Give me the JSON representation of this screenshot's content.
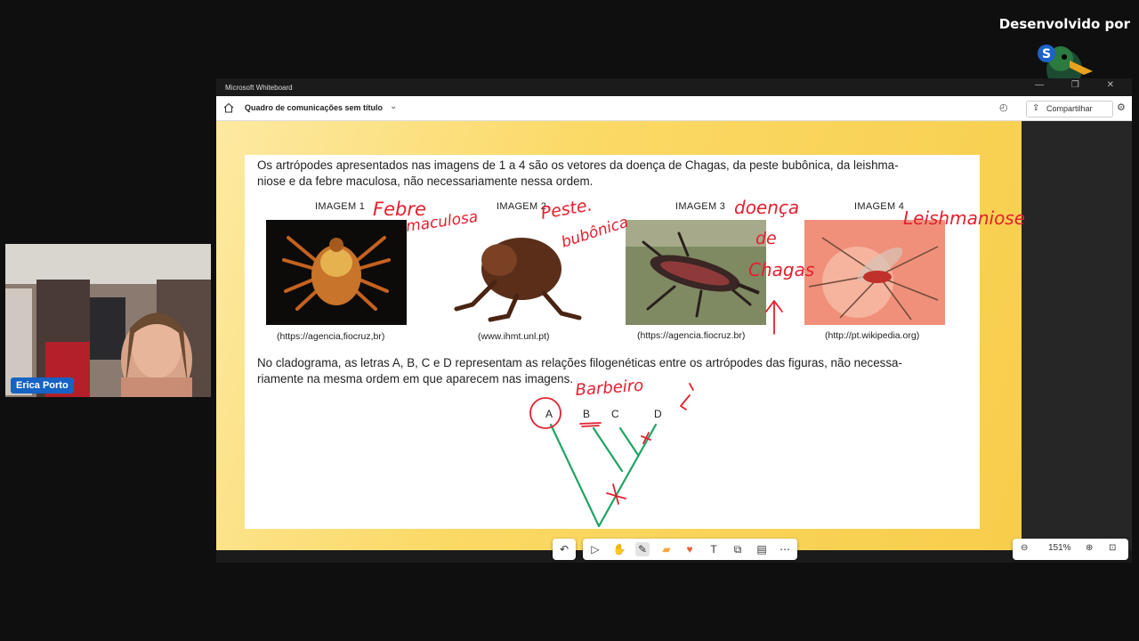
{
  "stream": {
    "brand_text": "Desenvolvido por",
    "presenter_name": "Erica Porto"
  },
  "window": {
    "app_title": "Microsoft Whiteboard",
    "board_title": "Quadro de comunicações sem título",
    "share_label": "Compartilhar"
  },
  "slide": {
    "intro_text": [
      "Os artrópodes apresentados nas imagens de 1 a 4 são os vetores da doença de Chagas, da peste bubônica, da leishma-",
      "niose e da febre maculosa, não necessariamente nessa ordem."
    ],
    "images": [
      {
        "label": "IMAGEM 1",
        "source": "(https://agencia,fiocruz,br)",
        "handwritten": [
          "Febre",
          "maculosa"
        ]
      },
      {
        "label": "IMAGEM 2",
        "source": "(www.ihmt.unl.pt)",
        "handwritten": [
          "Peste.",
          "bubônica"
        ]
      },
      {
        "label": "IMAGEM 3",
        "source": "(https://agencia.fiocruz.br)",
        "handwritten": [
          "doença",
          "de",
          "Chagas"
        ]
      },
      {
        "label": "IMAGEM 4",
        "source": "(http://pt.wikipedia.org)",
        "handwritten": [
          "Leishmaniose"
        ]
      }
    ],
    "clado_text": [
      "No cladograma, as letras A, B, C e D representam as relações filogenéticas entre os artrópodes das figuras, não necessa-",
      "riamente na mesma ordem em que aparecem nas imagens."
    ],
    "clado_letters": [
      "A",
      "B",
      "C",
      "D"
    ],
    "clado_annotation": "Barbeiro"
  },
  "zoom": {
    "level": "151%"
  },
  "colors": {
    "ink": "#e2202f",
    "clado_lines": "#1fa463",
    "canvas": "#f9d45e",
    "name_tag": "#1763c5"
  }
}
